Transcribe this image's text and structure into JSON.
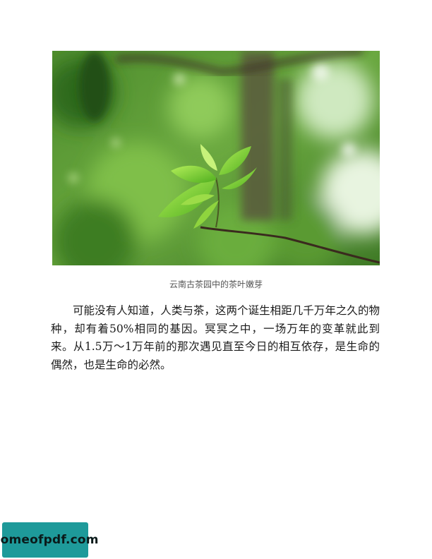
{
  "figure": {
    "caption": "云南古茶园中的茶叶嫩芽",
    "image_subject": "tea-leaf-bud-photo"
  },
  "body": {
    "paragraph": "可能没有人知道，人类与茶，这两个诞生相距几千万年之久的物种，却有着50%相同的基因。冥冥之中，一场万年的变革就此到来。从1.5万～1万年前的那次遇见直至今日的相互依存，是生命的偶然，也是生命的必然。"
  },
  "watermark": {
    "text": "homeofpdf.com"
  },
  "colors": {
    "background_green": "#5c9a3a",
    "leaf_green": "#7ccf2e",
    "branch_brown": "#3a2a1e",
    "watermark_teal": "#1e9a9a"
  }
}
